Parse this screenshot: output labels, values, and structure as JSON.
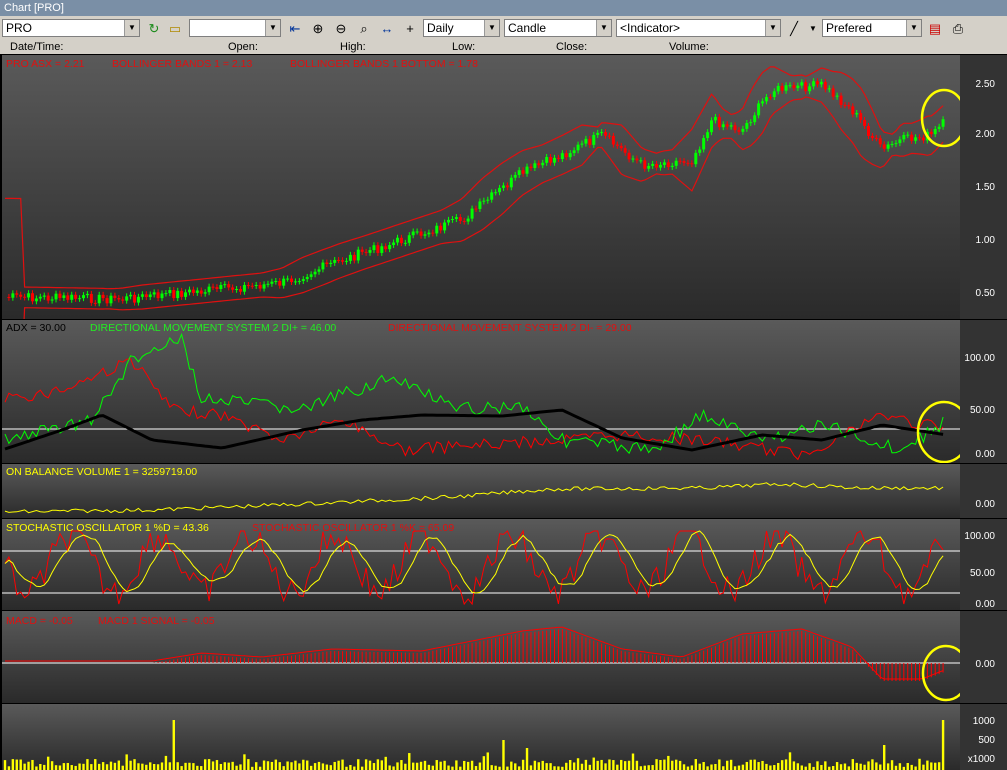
{
  "window": {
    "title": "Chart [PRO]"
  },
  "toolbar": {
    "symbol": "PRO",
    "period": "Daily",
    "chart_type": "Candle",
    "indicator": "<Indicator>",
    "style": "Prefered"
  },
  "info": {
    "date_label": "Date/Time:",
    "open_label": "Open:",
    "high_label": "High:",
    "low_label": "Low:",
    "close_label": "Close:",
    "volume_label": "Volume:"
  },
  "panels": {
    "price": {
      "label": "PRO ASX = 2.21",
      "bb_top": "BOLLINGER BANDS 1 = 2.13",
      "bb_bottom": "BOLLINGER BANDS 1 BOTTOM = 1.78",
      "ticks": [
        "2.50",
        "2.00",
        "1.50",
        "1.00",
        "0.50"
      ]
    },
    "dms": {
      "adx": "ADX = 30.00",
      "di_plus": "DIRECTIONAL MOVEMENT SYSTEM 2 DI+ = 46.00",
      "di_minus": "DIRECTIONAL MOVEMENT SYSTEM 2 DI- = 29.00",
      "ticks": [
        "100.00",
        "50.00",
        "0.00"
      ]
    },
    "obv": {
      "label": "ON BALANCE VOLUME 1 = 3259719.00",
      "ticks": [
        "0.00"
      ]
    },
    "stoch": {
      "d": "STOCHASTIC OSCILLATOR 1 %D = 43.36",
      "k": "STOCHASTIC OSCILLATOR 1 %K = 65.09",
      "ticks": [
        "100.00",
        "50.00",
        "0.00"
      ]
    },
    "macd": {
      "macd": "MACD = -0.05",
      "signal": "MACD 1 SIGNAL = -0.05",
      "ticks": [
        "0.00"
      ]
    },
    "volume": {
      "ticks": [
        "1000",
        "500",
        "x1000"
      ]
    }
  },
  "colors": {
    "up": "#00ff00",
    "down": "#ff0000",
    "band": "#e01010",
    "yellow": "#ffff00"
  },
  "icons": [
    "refresh-icon",
    "folder-icon",
    "left-end-icon",
    "zoom-in-icon",
    "zoom-out-icon",
    "zoom-fit-icon",
    "stretch-icon",
    "crosshair-icon",
    "line-tool-icon",
    "save-icon",
    "print-icon"
  ]
}
